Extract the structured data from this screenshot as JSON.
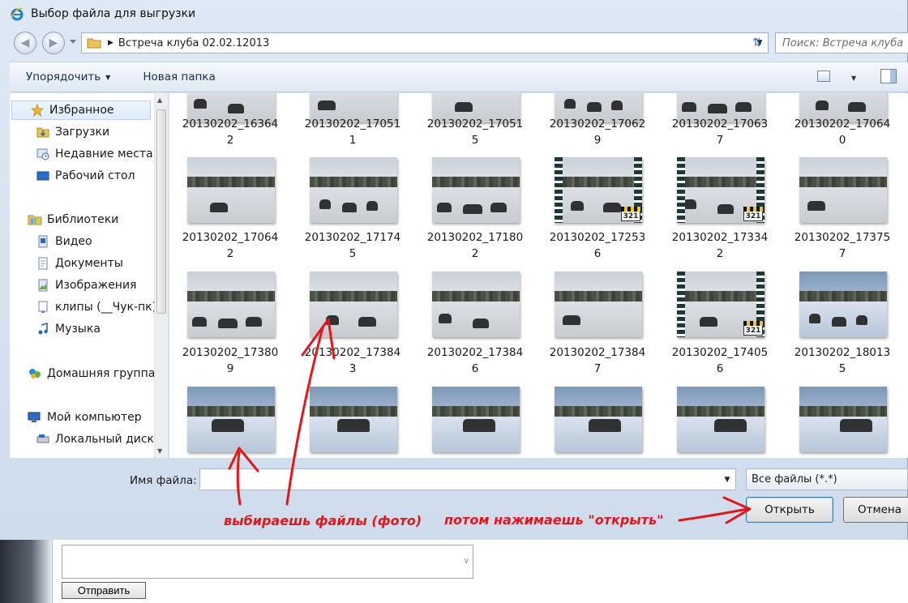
{
  "window": {
    "title": "Выбор файла для выгрузки"
  },
  "nav": {
    "path": "Встреча клуба 02.02.12013",
    "search_placeholder": "Поиск: Встреча клуба"
  },
  "toolbar": {
    "organize": "Упорядочить",
    "new_folder": "Новая папка"
  },
  "sidebar": {
    "items": [
      {
        "label": "Избранное",
        "icon": "star-icon"
      },
      {
        "label": "Загрузки",
        "icon": "downloads-icon"
      },
      {
        "label": "Недавние места",
        "icon": "recent-places-icon"
      },
      {
        "label": "Рабочий стол",
        "icon": "desktop-icon"
      },
      {
        "label": "Библиотеки",
        "icon": "libraries-icon"
      },
      {
        "label": "Видео",
        "icon": "video-library-icon"
      },
      {
        "label": "Документы",
        "icon": "documents-icon"
      },
      {
        "label": "Изображения",
        "icon": "pictures-icon"
      },
      {
        "label": "клипы (__Чук-пк)",
        "icon": "network-folder-icon"
      },
      {
        "label": "Музыка",
        "icon": "music-icon"
      },
      {
        "label": "Домашняя группа",
        "icon": "homegroup-icon"
      },
      {
        "label": "Мой компьютер",
        "icon": "computer-icon"
      },
      {
        "label": "Локальный диск",
        "icon": "drive-icon"
      }
    ]
  },
  "files": {
    "row0": [
      {
        "l1": "20130202_16364",
        "l2": "2"
      },
      {
        "l1": "20130202_17051",
        "l2": "1"
      },
      {
        "l1": "20130202_17051",
        "l2": "5"
      },
      {
        "l1": "20130202_17062",
        "l2": "9"
      },
      {
        "l1": "20130202_17063",
        "l2": "7"
      },
      {
        "l1": "20130202_17064",
        "l2": "0"
      }
    ],
    "row1": [
      {
        "l1": "20130202_17064",
        "l2": "2",
        "kind": "photo"
      },
      {
        "l1": "20130202_17174",
        "l2": "5",
        "kind": "photo"
      },
      {
        "l1": "20130202_17180",
        "l2": "2",
        "kind": "photo"
      },
      {
        "l1": "20130202_17253",
        "l2": "6",
        "kind": "video"
      },
      {
        "l1": "20130202_17334",
        "l2": "2",
        "kind": "video"
      },
      {
        "l1": "20130202_17375",
        "l2": "7",
        "kind": "photo"
      }
    ],
    "row2": [
      {
        "l1": "20130202_17380",
        "l2": "9",
        "kind": "photo"
      },
      {
        "l1": "20130202_17384",
        "l2": "3",
        "kind": "photo"
      },
      {
        "l1": "20130202_17384",
        "l2": "6",
        "kind": "photo"
      },
      {
        "l1": "20130202_17384",
        "l2": "7",
        "kind": "photo"
      },
      {
        "l1": "20130202_17405",
        "l2": "6",
        "kind": "video"
      },
      {
        "l1": "20130202_18013",
        "l2": "5",
        "kind": "photo"
      }
    ],
    "video_badge": "321"
  },
  "bottom": {
    "filename_label": "Имя файла:",
    "filename_value": "",
    "filter": "Все файлы (*.*)",
    "open": "Открыть",
    "cancel": "Отмена"
  },
  "behind": {
    "send": "Отправить"
  },
  "annotations": {
    "select_files": "выбираешь файлы (фото)",
    "then_open": "потом нажимаешь \"открыть\""
  },
  "colors": {
    "annotation": "#e4161b",
    "accent": "#3c7fb1"
  }
}
